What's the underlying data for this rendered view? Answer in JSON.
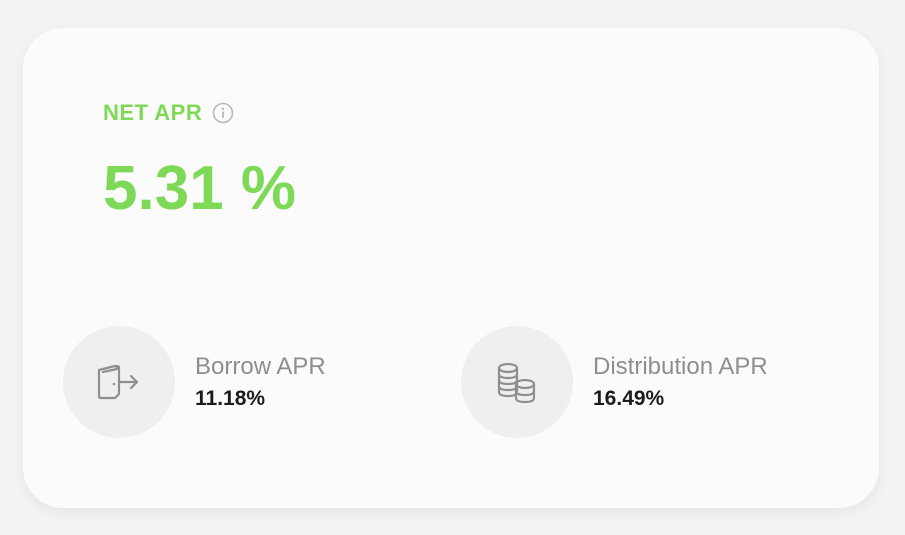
{
  "net_apr": {
    "label": "NET APR",
    "value": "5.31 %",
    "info_icon": "info-icon",
    "color": "#7ed957"
  },
  "stats": [
    {
      "label": "Borrow APR",
      "value": "11.18%",
      "icon": "borrow-icon"
    },
    {
      "label": "Distribution APR",
      "value": "16.49%",
      "icon": "coins-icon"
    }
  ]
}
